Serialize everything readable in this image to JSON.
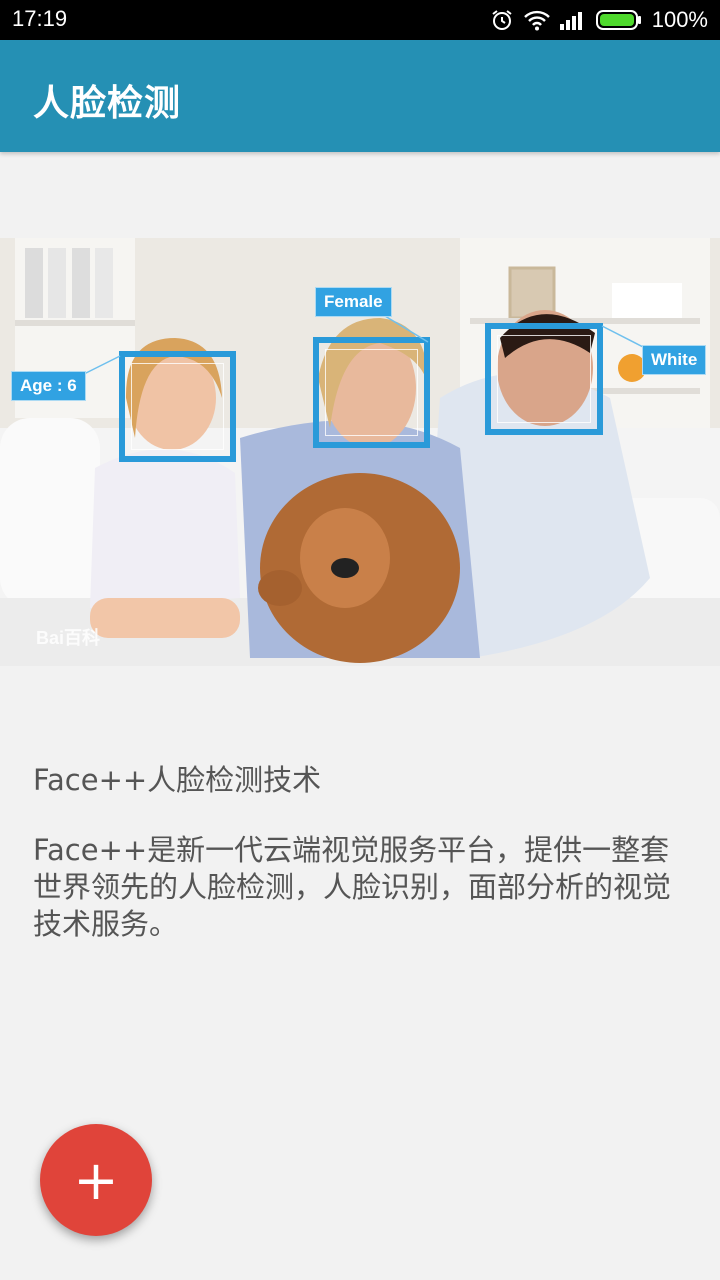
{
  "status_bar": {
    "time": "17:19",
    "battery_percent": "100%",
    "icons": [
      "alarm-icon",
      "wifi-icon",
      "signal-icon",
      "battery-icon"
    ]
  },
  "app_bar": {
    "title": "人脸检测"
  },
  "hero_image": {
    "tags": {
      "age": "Age : 6",
      "gender": "Female",
      "race": "White"
    },
    "watermark": "Bai百科"
  },
  "content": {
    "headline": "Face++人脸检测技术",
    "description": "Face++是新一代云端视觉服务平台，提供一整套世界领先的人脸检测，人脸识别，面部分析的视觉技术服务。"
  },
  "fab": {
    "icon": "plus-icon",
    "label": "+",
    "color": "#e0443a"
  },
  "colors": {
    "app_bar": "#2590b4",
    "face_box": "#2a9ad9",
    "background": "#f2f2f2"
  }
}
